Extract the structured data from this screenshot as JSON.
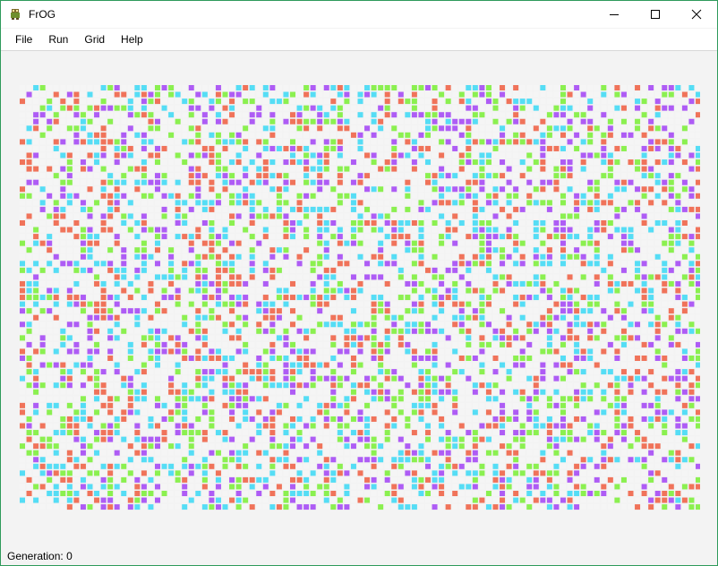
{
  "window": {
    "title": "FrOG"
  },
  "title_buttons": {
    "minimize": "minimize",
    "maximize": "maximize",
    "close": "close"
  },
  "menu": [
    "File",
    "Run",
    "Grid",
    "Help"
  ],
  "grid": {
    "columns": 101,
    "rows": 63,
    "colors": {
      "empty": "#f5f5f5",
      "red": "#f0735a",
      "green": "#8bf050",
      "cyan": "#55ddf5",
      "purple": "#ae5cf5"
    },
    "seed": 20241
  },
  "status": {
    "generation_label": "Generation:",
    "generation_value": "0"
  }
}
